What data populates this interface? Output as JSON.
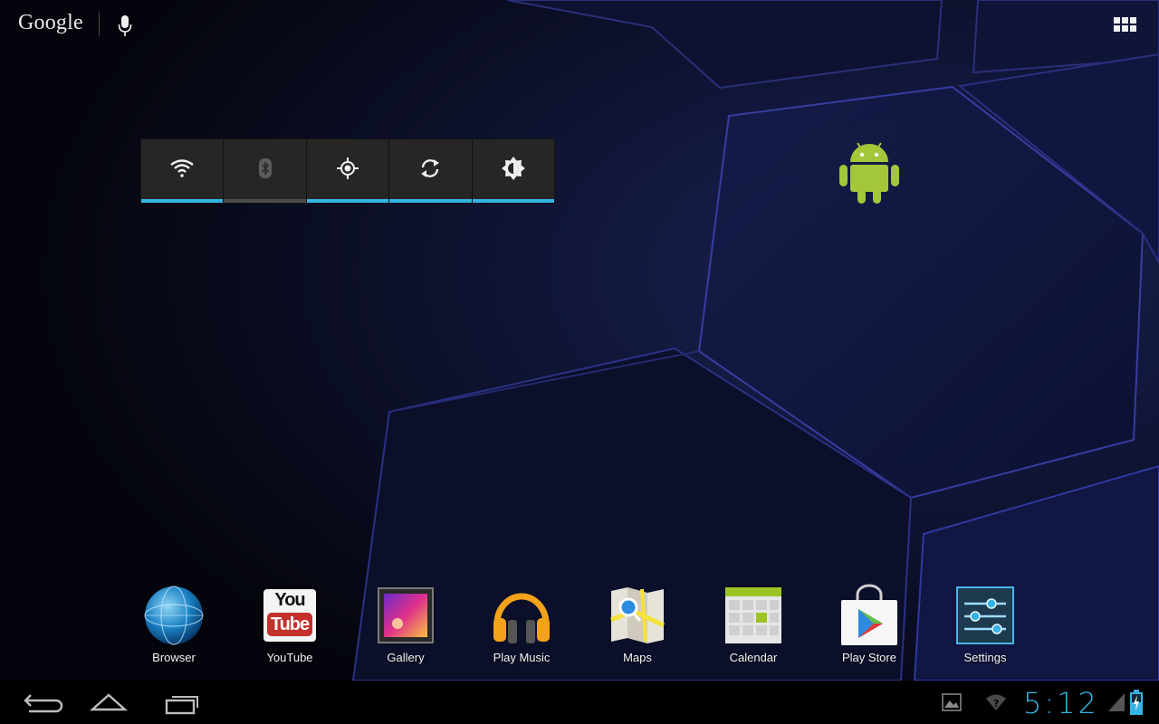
{
  "search": {
    "logo_text": "Google",
    "mic_icon": "mic-icon"
  },
  "apps_button": {
    "icon": "all-apps-grid-icon"
  },
  "power_widget": {
    "accent_color": "#33b5e5",
    "buttons": [
      {
        "name": "wifi",
        "icon": "wifi-icon",
        "state": "on"
      },
      {
        "name": "bluetooth",
        "icon": "bluetooth-icon",
        "state": "off"
      },
      {
        "name": "gps",
        "icon": "location-icon",
        "state": "on"
      },
      {
        "name": "sync",
        "icon": "sync-icon",
        "state": "on"
      },
      {
        "name": "brightness",
        "icon": "brightness-icon",
        "state": "on"
      }
    ]
  },
  "android_widget": {
    "icon": "android-robot-icon",
    "color": "#a4c639"
  },
  "dock": {
    "items": [
      {
        "label": "Browser",
        "icon": "browser-globe-icon"
      },
      {
        "label": "YouTube",
        "icon": "youtube-icon",
        "icon_text_top": "You",
        "icon_text_bottom": "Tube"
      },
      {
        "label": "Gallery",
        "icon": "gallery-icon"
      },
      {
        "label": "Play Music",
        "icon": "headphones-icon"
      },
      {
        "label": "Maps",
        "icon": "maps-icon"
      },
      {
        "label": "Calendar",
        "icon": "calendar-icon"
      },
      {
        "label": "Play Store",
        "icon": "play-store-bag-icon"
      },
      {
        "label": "Settings",
        "icon": "settings-sliders-icon"
      }
    ]
  },
  "nav_bar": {
    "buttons": [
      {
        "name": "back",
        "icon": "back-icon"
      },
      {
        "name": "home",
        "icon": "home-icon"
      },
      {
        "name": "recents",
        "icon": "recent-apps-icon"
      }
    ]
  },
  "status": {
    "notification_icon": "screenshot-image-icon",
    "wifi_icon": "wifi-no-signal-icon",
    "signal_icon": "cell-signal-icon",
    "battery_icon": "battery-charging-icon",
    "clock": "5:12",
    "clock_color": "#33b5e5"
  }
}
